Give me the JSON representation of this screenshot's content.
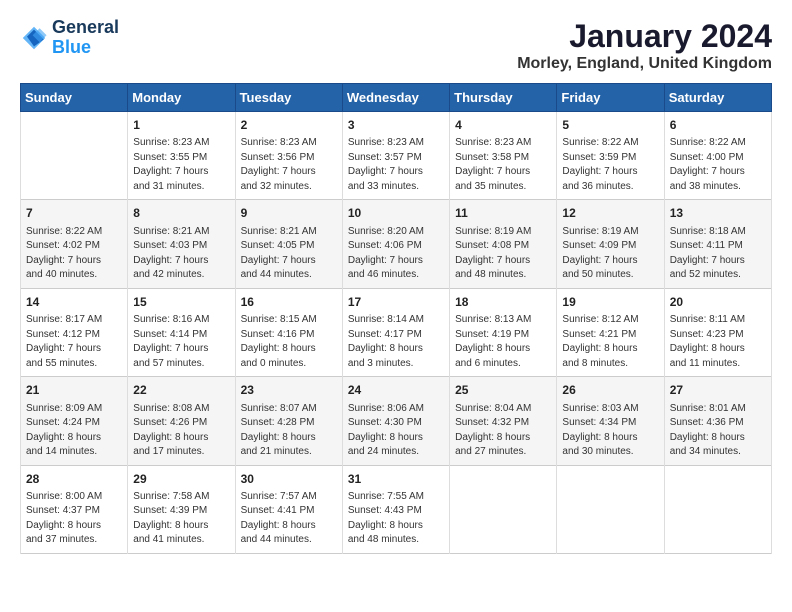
{
  "logo": {
    "line1": "General",
    "line2": "Blue"
  },
  "title": "January 2024",
  "location": "Morley, England, United Kingdom",
  "weekdays": [
    "Sunday",
    "Monday",
    "Tuesday",
    "Wednesday",
    "Thursday",
    "Friday",
    "Saturday"
  ],
  "weeks": [
    [
      {
        "day": "",
        "info": ""
      },
      {
        "day": "1",
        "info": "Sunrise: 8:23 AM\nSunset: 3:55 PM\nDaylight: 7 hours\nand 31 minutes."
      },
      {
        "day": "2",
        "info": "Sunrise: 8:23 AM\nSunset: 3:56 PM\nDaylight: 7 hours\nand 32 minutes."
      },
      {
        "day": "3",
        "info": "Sunrise: 8:23 AM\nSunset: 3:57 PM\nDaylight: 7 hours\nand 33 minutes."
      },
      {
        "day": "4",
        "info": "Sunrise: 8:23 AM\nSunset: 3:58 PM\nDaylight: 7 hours\nand 35 minutes."
      },
      {
        "day": "5",
        "info": "Sunrise: 8:22 AM\nSunset: 3:59 PM\nDaylight: 7 hours\nand 36 minutes."
      },
      {
        "day": "6",
        "info": "Sunrise: 8:22 AM\nSunset: 4:00 PM\nDaylight: 7 hours\nand 38 minutes."
      }
    ],
    [
      {
        "day": "7",
        "info": "Sunrise: 8:22 AM\nSunset: 4:02 PM\nDaylight: 7 hours\nand 40 minutes."
      },
      {
        "day": "8",
        "info": "Sunrise: 8:21 AM\nSunset: 4:03 PM\nDaylight: 7 hours\nand 42 minutes."
      },
      {
        "day": "9",
        "info": "Sunrise: 8:21 AM\nSunset: 4:05 PM\nDaylight: 7 hours\nand 44 minutes."
      },
      {
        "day": "10",
        "info": "Sunrise: 8:20 AM\nSunset: 4:06 PM\nDaylight: 7 hours\nand 46 minutes."
      },
      {
        "day": "11",
        "info": "Sunrise: 8:19 AM\nSunset: 4:08 PM\nDaylight: 7 hours\nand 48 minutes."
      },
      {
        "day": "12",
        "info": "Sunrise: 8:19 AM\nSunset: 4:09 PM\nDaylight: 7 hours\nand 50 minutes."
      },
      {
        "day": "13",
        "info": "Sunrise: 8:18 AM\nSunset: 4:11 PM\nDaylight: 7 hours\nand 52 minutes."
      }
    ],
    [
      {
        "day": "14",
        "info": "Sunrise: 8:17 AM\nSunset: 4:12 PM\nDaylight: 7 hours\nand 55 minutes."
      },
      {
        "day": "15",
        "info": "Sunrise: 8:16 AM\nSunset: 4:14 PM\nDaylight: 7 hours\nand 57 minutes."
      },
      {
        "day": "16",
        "info": "Sunrise: 8:15 AM\nSunset: 4:16 PM\nDaylight: 8 hours\nand 0 minutes."
      },
      {
        "day": "17",
        "info": "Sunrise: 8:14 AM\nSunset: 4:17 PM\nDaylight: 8 hours\nand 3 minutes."
      },
      {
        "day": "18",
        "info": "Sunrise: 8:13 AM\nSunset: 4:19 PM\nDaylight: 8 hours\nand 6 minutes."
      },
      {
        "day": "19",
        "info": "Sunrise: 8:12 AM\nSunset: 4:21 PM\nDaylight: 8 hours\nand 8 minutes."
      },
      {
        "day": "20",
        "info": "Sunrise: 8:11 AM\nSunset: 4:23 PM\nDaylight: 8 hours\nand 11 minutes."
      }
    ],
    [
      {
        "day": "21",
        "info": "Sunrise: 8:09 AM\nSunset: 4:24 PM\nDaylight: 8 hours\nand 14 minutes."
      },
      {
        "day": "22",
        "info": "Sunrise: 8:08 AM\nSunset: 4:26 PM\nDaylight: 8 hours\nand 17 minutes."
      },
      {
        "day": "23",
        "info": "Sunrise: 8:07 AM\nSunset: 4:28 PM\nDaylight: 8 hours\nand 21 minutes."
      },
      {
        "day": "24",
        "info": "Sunrise: 8:06 AM\nSunset: 4:30 PM\nDaylight: 8 hours\nand 24 minutes."
      },
      {
        "day": "25",
        "info": "Sunrise: 8:04 AM\nSunset: 4:32 PM\nDaylight: 8 hours\nand 27 minutes."
      },
      {
        "day": "26",
        "info": "Sunrise: 8:03 AM\nSunset: 4:34 PM\nDaylight: 8 hours\nand 30 minutes."
      },
      {
        "day": "27",
        "info": "Sunrise: 8:01 AM\nSunset: 4:36 PM\nDaylight: 8 hours\nand 34 minutes."
      }
    ],
    [
      {
        "day": "28",
        "info": "Sunrise: 8:00 AM\nSunset: 4:37 PM\nDaylight: 8 hours\nand 37 minutes."
      },
      {
        "day": "29",
        "info": "Sunrise: 7:58 AM\nSunset: 4:39 PM\nDaylight: 8 hours\nand 41 minutes."
      },
      {
        "day": "30",
        "info": "Sunrise: 7:57 AM\nSunset: 4:41 PM\nDaylight: 8 hours\nand 44 minutes."
      },
      {
        "day": "31",
        "info": "Sunrise: 7:55 AM\nSunset: 4:43 PM\nDaylight: 8 hours\nand 48 minutes."
      },
      {
        "day": "",
        "info": ""
      },
      {
        "day": "",
        "info": ""
      },
      {
        "day": "",
        "info": ""
      }
    ]
  ]
}
